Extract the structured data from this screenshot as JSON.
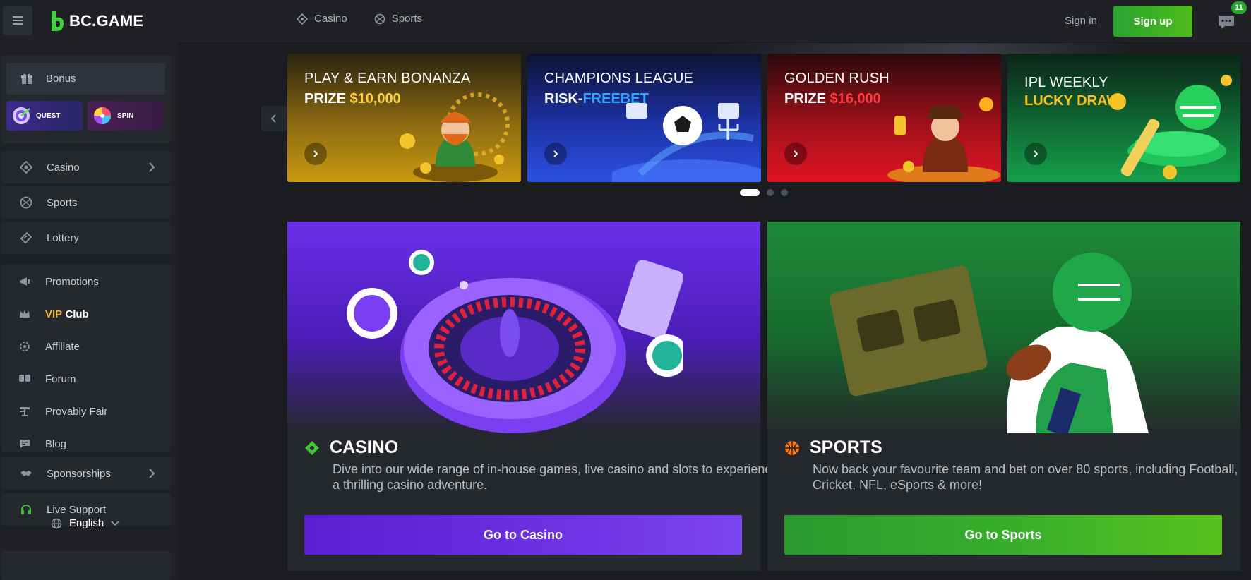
{
  "header": {
    "brand": "BC.GAME",
    "nav": [
      {
        "label": "Casino",
        "icon": "casino-diamond-icon"
      },
      {
        "label": "Sports",
        "icon": "sports-ball-icon"
      }
    ],
    "signin_label": "Sign in",
    "signup_label": "Sign up",
    "chat_badge": "11"
  },
  "sidebar": {
    "bonus_label": "Bonus",
    "quest_label": "QUEST",
    "spin_label": "SPIN",
    "primary": [
      {
        "label": "Casino",
        "icon": "casino-diamond-icon",
        "has_chevron": true
      },
      {
        "label": "Sports",
        "icon": "sports-ball-icon"
      },
      {
        "label": "Lottery",
        "icon": "lottery-ticket-icon"
      }
    ],
    "secondary": [
      {
        "label": "Promotions",
        "icon": "promotions-icon"
      },
      {
        "label_gold": "VIP",
        "label_white": "Club",
        "icon": "crown-icon"
      },
      {
        "label": "Affiliate",
        "icon": "affiliate-icon"
      },
      {
        "label": "Forum",
        "icon": "forum-icon"
      },
      {
        "label": "Provably Fair",
        "icon": "provably-fair-icon"
      },
      {
        "label": "Blog",
        "icon": "blog-icon"
      }
    ],
    "sponsorships_label": "Sponsorships",
    "live_support_label": "Live Support",
    "language": "English"
  },
  "banners": [
    {
      "line1": "PLAY & EARN BONANZA",
      "line2_prefix": "PRIZE ",
      "line2_accent": "$10,000",
      "accent_color": "#ffd23f"
    },
    {
      "line1": "CHAMPIONS LEAGUE",
      "line2_prefix": "RISK-",
      "line2_accent": "FREEBET",
      "accent_color": "#35a3ff"
    },
    {
      "line1": "GOLDEN RUSH",
      "line2_prefix": "PRIZE ",
      "line2_accent": "$16,000",
      "accent_color": "#ff3b3b"
    },
    {
      "line1": "IPL WEEKLY",
      "line2_prefix": "",
      "line2_accent": "LUCKY DRAW",
      "accent_color": "#ffc21a"
    }
  ],
  "carousel": {
    "pages": 3,
    "active": 1
  },
  "cards": {
    "casino": {
      "title": "CASINO",
      "description": "Dive into our wide range of in-house games, live casino and slots to experience a thrilling casino adventure.",
      "button": "Go to Casino"
    },
    "sports": {
      "title": "SPORTS",
      "description": "Now back your favourite team and bet on over 80 sports, including Football, Cricket, NFL, eSports & more!",
      "button": "Go to Sports"
    }
  },
  "colors": {
    "brand_green": "#2aa32f",
    "vip_gold": "#f3b72b",
    "casino_purple": "#6d2fe0",
    "sports_green": "#2e9e34"
  }
}
